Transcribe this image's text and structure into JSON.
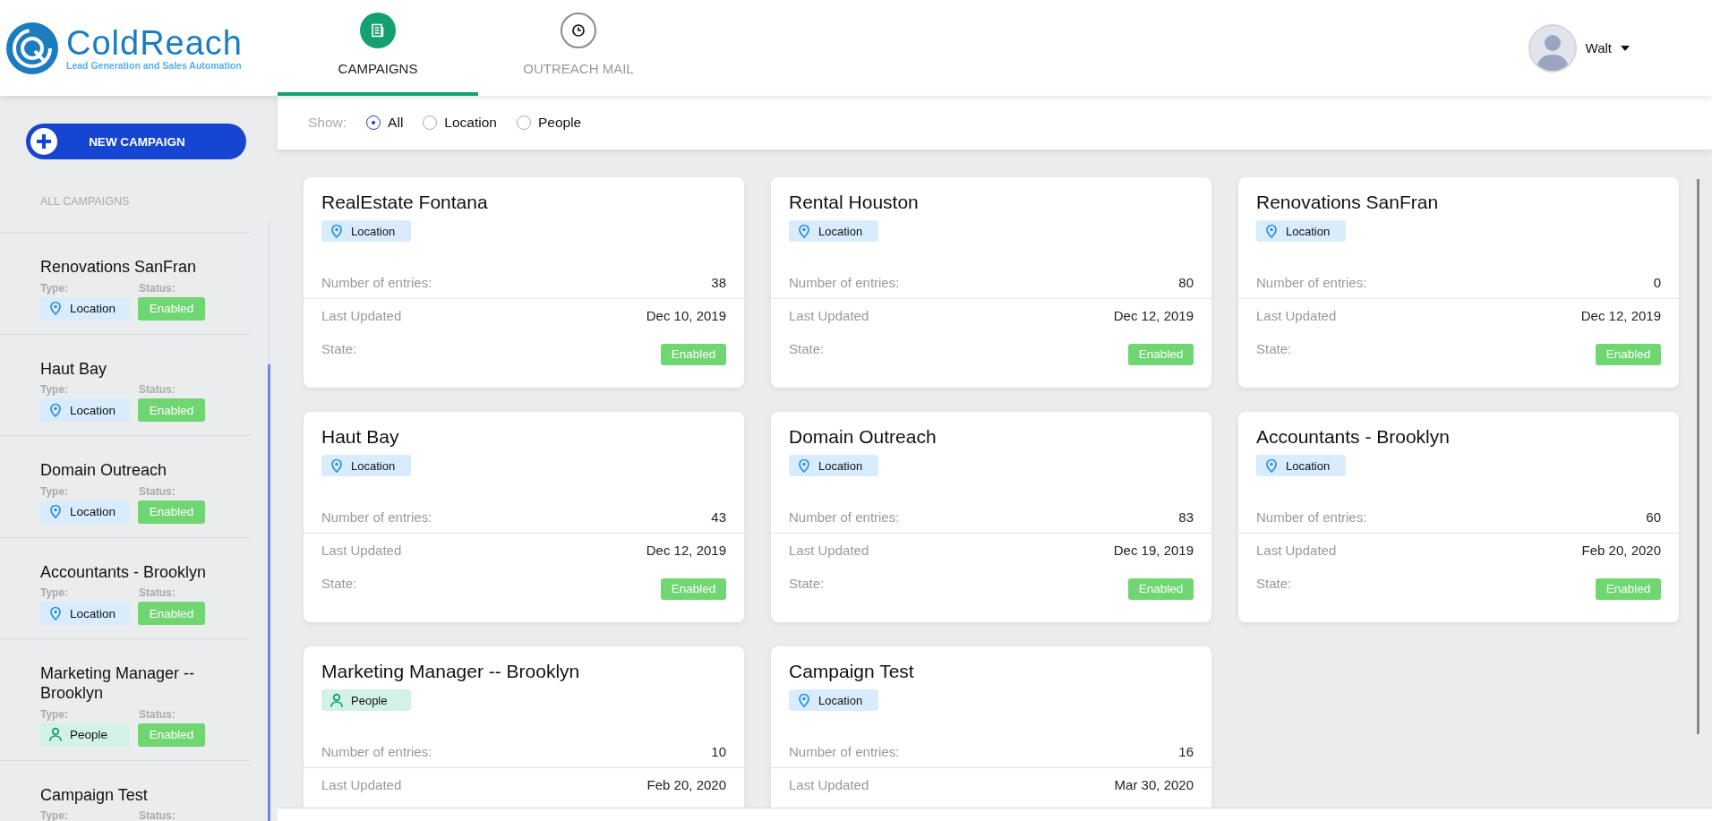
{
  "logo": {
    "name": "ColdReach",
    "tagline": "Lead Generation and Sales Automation"
  },
  "tabs": [
    {
      "label": "CAMPAIGNS",
      "kind": "campaigns",
      "selected": true
    },
    {
      "label": "OUTREACH MAIL",
      "kind": "mail",
      "selected": false
    }
  ],
  "user": {
    "name": "Walt"
  },
  "sidebar": {
    "new_button": "NEW CAMPAIGN",
    "section_title": "ALL CAMPAIGNS",
    "items": [
      {
        "name": "Renovations SanFran",
        "type_label": "Type:",
        "status_label": "Status:",
        "type": {
          "kind": "location",
          "label": "Location"
        },
        "status": "Enabled"
      },
      {
        "name": "Haut Bay",
        "type_label": "Type:",
        "status_label": "Status:",
        "type": {
          "kind": "location",
          "label": "Location"
        },
        "status": "Enabled"
      },
      {
        "name": "Domain Outreach",
        "type_label": "Type:",
        "status_label": "Status:",
        "type": {
          "kind": "location",
          "label": "Location"
        },
        "status": "Enabled"
      },
      {
        "name": "Accountants - Brooklyn",
        "type_label": "Type:",
        "status_label": "Status:",
        "type": {
          "kind": "location",
          "label": "Location"
        },
        "status": "Enabled"
      },
      {
        "name": "Marketing Manager -- Brooklyn",
        "type_label": "Type:",
        "status_label": "Status:",
        "type": {
          "kind": "people",
          "label": "People"
        },
        "status": "Enabled"
      },
      {
        "name": "Campaign Test",
        "type_label": "Type:",
        "status_label": "Status:"
      }
    ]
  },
  "filter": {
    "label": "Show:",
    "options": [
      {
        "label": "All",
        "selected": true
      },
      {
        "label": "Location",
        "selected": false
      },
      {
        "label": "People",
        "selected": false
      }
    ]
  },
  "cards": [
    {
      "name": "RealEstate Fontana",
      "type": {
        "kind": "location",
        "label": "Location"
      },
      "rows": [
        {
          "label": "Number of entries:",
          "value": "38"
        },
        {
          "label": "Last Updated",
          "value": "Dec 10, 2019"
        }
      ],
      "state_label": "State:",
      "state": "Enabled"
    },
    {
      "name": "Rental Houston",
      "type": {
        "kind": "location",
        "label": "Location"
      },
      "rows": [
        {
          "label": "Number of entries:",
          "value": "80"
        },
        {
          "label": "Last Updated",
          "value": "Dec 12, 2019"
        }
      ],
      "state_label": "State:",
      "state": "Enabled"
    },
    {
      "name": "Renovations SanFran",
      "type": {
        "kind": "location",
        "label": "Location"
      },
      "rows": [
        {
          "label": "Number of entries:",
          "value": "0"
        },
        {
          "label": "Last Updated",
          "value": "Dec 12, 2019"
        }
      ],
      "state_label": "State:",
      "state": "Enabled"
    },
    {
      "name": "Haut Bay",
      "type": {
        "kind": "location",
        "label": "Location"
      },
      "rows": [
        {
          "label": "Number of entries:",
          "value": "43"
        },
        {
          "label": "Last Updated",
          "value": "Dec 12, 2019"
        }
      ],
      "state_label": "State:",
      "state": "Enabled"
    },
    {
      "name": "Domain Outreach",
      "type": {
        "kind": "location",
        "label": "Location"
      },
      "rows": [
        {
          "label": "Number of entries:",
          "value": "83"
        },
        {
          "label": "Last Updated",
          "value": "Dec 19, 2019"
        }
      ],
      "state_label": "State:",
      "state": "Enabled"
    },
    {
      "name": "Accountants - Brooklyn",
      "type": {
        "kind": "location",
        "label": "Location"
      },
      "rows": [
        {
          "label": "Number of entries:",
          "value": "60"
        },
        {
          "label": "Last Updated",
          "value": "Feb 20, 2020"
        }
      ],
      "state_label": "State:",
      "state": "Enabled"
    },
    {
      "name": "Marketing Manager -- Brooklyn",
      "type": {
        "kind": "people",
        "label": "People"
      },
      "rows": [
        {
          "label": "Number of entries:",
          "value": "10"
        },
        {
          "label": "Last Updated",
          "value": "Feb 20, 2020"
        }
      ]
    },
    {
      "name": "Campaign Test",
      "type": {
        "kind": "location",
        "label": "Location"
      },
      "rows": [
        {
          "label": "Number of entries:",
          "value": "16"
        },
        {
          "label": "Last Updated",
          "value": "Mar 30, 2020"
        }
      ]
    }
  ]
}
